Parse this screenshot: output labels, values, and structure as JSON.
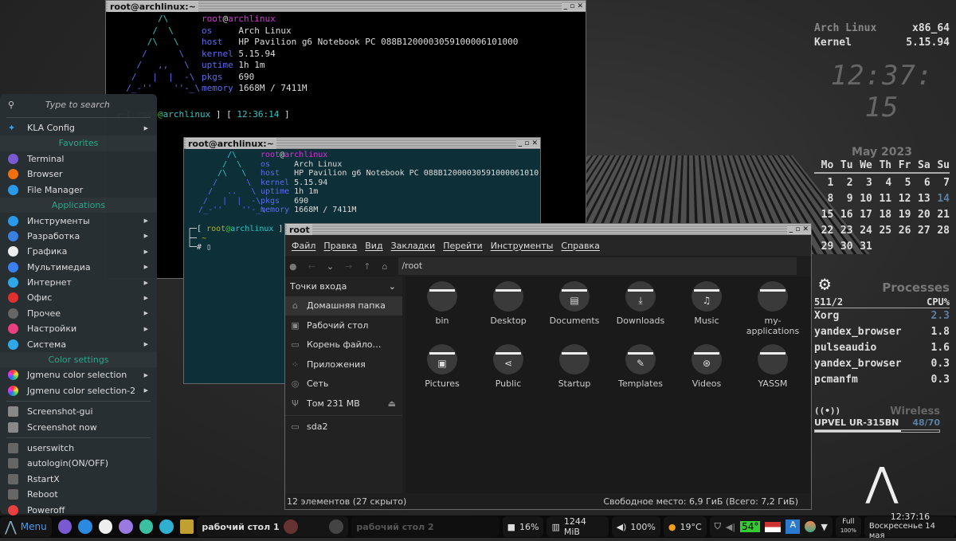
{
  "term1": {
    "title": "root@archlinux:~",
    "user": "root",
    "host": "archlinux",
    "os": "Arch Linux",
    "host_model": "HP Pavilion g6 Notebook PC 088B12000030591000061010",
    "host_model_full": "HP Pavilion g6 Notebook PC 088B1200003059100006101000",
    "kernel": "5.15.94",
    "uptime": "1h 1m",
    "pkgs": "690",
    "memory": "1668M / 7411M",
    "prompt_time": "12:36:14",
    "labels": {
      "os": "os",
      "host": "host",
      "kernel": "kernel",
      "uptime": "uptime",
      "pkgs": "pkgs",
      "memory": "memory"
    }
  },
  "term2": {
    "title": "root@archlinux:~",
    "cwd": "~"
  },
  "menu": {
    "search_placeholder": "Type to search",
    "kla": "KLA Config",
    "favorites_header": "Favorites",
    "favorites": [
      "Terminal",
      "Browser",
      "File Manager"
    ],
    "apps_header": "Applications",
    "apps": [
      "Инструменты",
      "Разработка",
      "Графика",
      "Мультимедиа",
      "Интернет",
      "Офис",
      "Прочее",
      "Настройки",
      "Система"
    ],
    "color_header": "Color settings",
    "colors": [
      "Jgmenu color selection",
      "Jgmenu color selection-2"
    ],
    "shots": [
      "Screenshot-gui",
      "Screenshot now"
    ],
    "power": [
      "userswitch",
      "autologin(ON/OFF)",
      "RstartX",
      "Reboot",
      "Poweroff"
    ]
  },
  "fm": {
    "title": "root",
    "menus": [
      "Файл",
      "Правка",
      "Вид",
      "Закладки",
      "Перейти",
      "Инструменты",
      "Справка"
    ],
    "path": "/root",
    "places_header": "Точки входа",
    "places": [
      "Домашняя папка",
      "Рабочий стол",
      "Корень файло…",
      "Приложения",
      "Сеть",
      "Том 231 MB",
      "sda2"
    ],
    "files": [
      "bin",
      "Desktop",
      "Documents",
      "Downloads",
      "Music",
      "my-applications",
      "Pictures",
      "Public",
      "Startup",
      "Templates",
      "Videos",
      "YASSM"
    ],
    "status_left": "12 элементов (27 скрыто)",
    "status_right": "Свободное место: 6,9 ГиБ (Всего: 7,2 ГиБ)"
  },
  "conky": {
    "distro": "Arch Linux",
    "arch": "x86_64",
    "kernel_label": "Kernel",
    "kernel": "5.15.94",
    "clock": "12:37: 15",
    "month": "May  2023",
    "days": [
      "Mo",
      "Tu",
      "We",
      "Th",
      "Fr",
      "Sa",
      "Su"
    ],
    "today": 14,
    "proc_title": "Processes",
    "proc_count": "511/2",
    "cpu_label": "CPU%",
    "procs": [
      {
        "name": "Xorg",
        "cpu": "2.3"
      },
      {
        "name": "yandex_browser",
        "cpu": "1.8"
      },
      {
        "name": "pulseaudio",
        "cpu": "1.6"
      },
      {
        "name": "yandex_browser",
        "cpu": "0.3"
      },
      {
        "name": "pcmanfm",
        "cpu": "0.3"
      }
    ],
    "wireless_title": "Wireless",
    "ssid": "UPVEL UR-315BN",
    "signal": "48/70",
    "signal_fraction": 0.69
  },
  "taskbar": {
    "menu": "Menu",
    "desk1": "рабочий стол 1",
    "desk2": "рабочий стол 2",
    "cpu": "16%",
    "mem": "1244 MiB",
    "vol": "100%",
    "weather": "19°C",
    "temp": "54°",
    "battery_state": "Full",
    "battery_pct": "100%",
    "time": "12:37:16",
    "date": "Воскресенье 14 мая"
  },
  "colors": {
    "accent": "#2aa88a",
    "terminal2_bg": "#0c2f38"
  }
}
